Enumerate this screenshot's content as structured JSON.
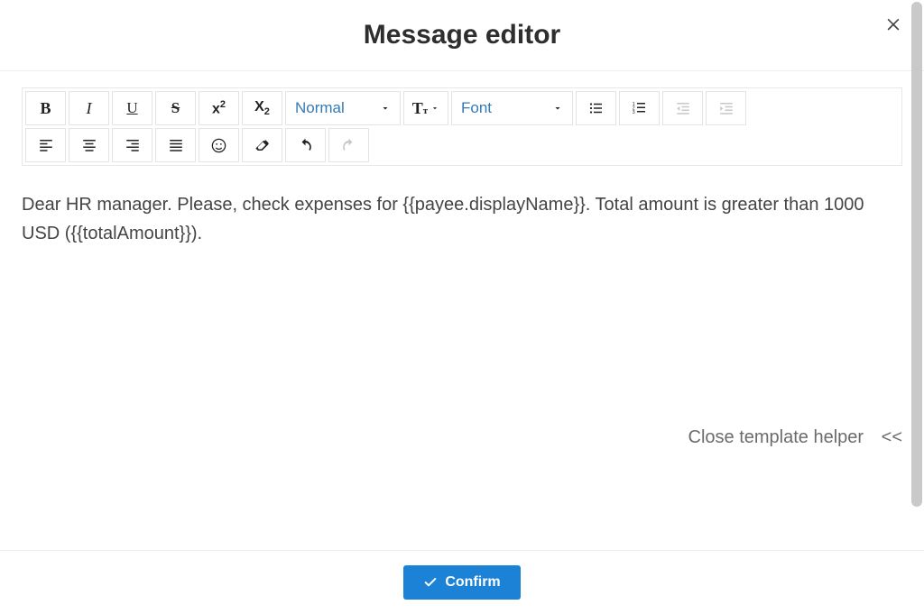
{
  "modal": {
    "title": "Message editor",
    "close_label": "×"
  },
  "toolbar": {
    "row1": {
      "bold": "B",
      "italic": "I",
      "underline": "U",
      "strike": "S",
      "superscript": "x²",
      "subscript": "x₂",
      "paragraph_select": "Normal",
      "font_size_label": "T",
      "font_select": "Font"
    }
  },
  "editor": {
    "content": "Dear HR manager. Please, check expenses for {{payee.displayName}}. Total amount is greater than 1000 USD ({{totalAmount}})."
  },
  "helper": {
    "label": "Close template helper",
    "chevrons": "<<"
  },
  "footer": {
    "confirm_label": "Confirm"
  }
}
